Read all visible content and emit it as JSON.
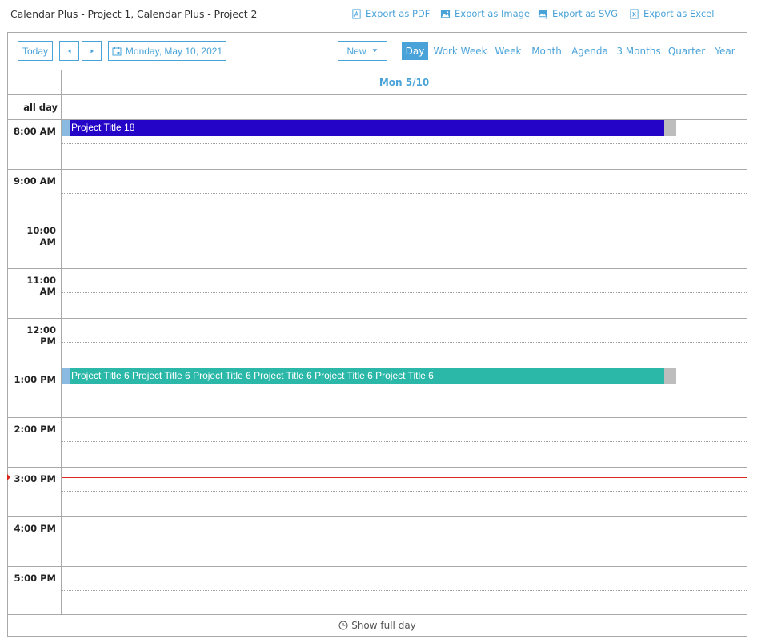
{
  "header": {
    "title": "Calendar Plus - Project 1, Calendar Plus - Project 2",
    "exports": [
      {
        "label": "Export as PDF",
        "icon": "pdf-file-icon"
      },
      {
        "label": "Export as Image",
        "icon": "image-icon"
      },
      {
        "label": "Export as SVG",
        "icon": "svg-image-icon"
      },
      {
        "label": "Export as Excel",
        "icon": "excel-file-icon"
      }
    ]
  },
  "toolbar": {
    "today_label": "Today",
    "prev_icon": "triangle-left-icon",
    "next_icon": "triangle-right-icon",
    "date_label": "Monday, May 10, 2021",
    "new_label": "New",
    "views": [
      {
        "label": "Day",
        "active": true
      },
      {
        "label": "Work Week",
        "active": false
      },
      {
        "label": "Week",
        "active": false
      },
      {
        "label": "Month",
        "active": false
      },
      {
        "label": "Agenda",
        "active": false
      },
      {
        "label": "3 Months",
        "active": false
      },
      {
        "label": "Quarter",
        "active": false
      },
      {
        "label": "Year",
        "active": false
      }
    ]
  },
  "calendar": {
    "day_header": "Mon 5/10",
    "all_day_label": "all day",
    "hours": [
      "8:00 AM",
      "9:00 AM",
      "10:00 AM",
      "11:00 AM",
      "12:00 PM",
      "1:00 PM",
      "2:00 PM",
      "3:00 PM",
      "4:00 PM",
      "5:00 PM"
    ],
    "events": [
      {
        "title": "Project Title 18",
        "start_hour": "8:00 AM",
        "color": "#2405c7"
      },
      {
        "title": "Project Title 6 Project Title 6 Project Title 6 Project Title 6 Project Title 6 Project Title 6",
        "start_hour": "1:00 PM",
        "color": "#2bb8a8"
      }
    ],
    "current_time": "3:00 PM",
    "now_line_color": "#d9261c",
    "accent_color": "#4aa3d8"
  },
  "footer": {
    "show_full_day_label": "Show full day"
  }
}
